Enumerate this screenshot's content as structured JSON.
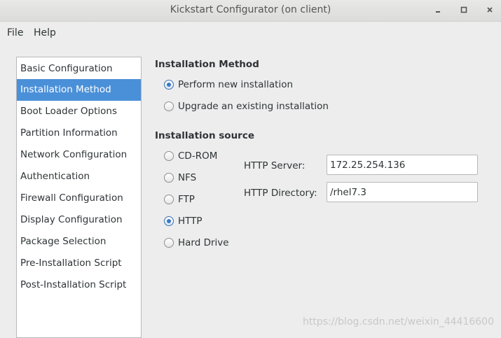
{
  "window": {
    "title": "Kickstart Configurator (on client)"
  },
  "menu": {
    "items": [
      {
        "label": "File"
      },
      {
        "label": "Help"
      }
    ]
  },
  "sidebar": {
    "items": [
      {
        "label": "Basic Configuration"
      },
      {
        "label": "Installation Method"
      },
      {
        "label": "Boot Loader Options"
      },
      {
        "label": "Partition Information"
      },
      {
        "label": "Network Configuration"
      },
      {
        "label": "Authentication"
      },
      {
        "label": "Firewall Configuration"
      },
      {
        "label": "Display Configuration"
      },
      {
        "label": "Package Selection"
      },
      {
        "label": "Pre-Installation Script"
      },
      {
        "label": "Post-Installation Script"
      }
    ],
    "selected": "Installation Method"
  },
  "installation_method": {
    "title": "Installation Method",
    "options": [
      {
        "label": "Perform new installation",
        "checked": true
      },
      {
        "label": "Upgrade an existing installation",
        "checked": false
      }
    ]
  },
  "installation_source": {
    "title": "Installation source",
    "options": [
      {
        "label": "CD-ROM",
        "checked": false
      },
      {
        "label": "NFS",
        "checked": false
      },
      {
        "label": "FTP",
        "checked": false
      },
      {
        "label": "HTTP",
        "checked": true
      },
      {
        "label": "Hard Drive",
        "checked": false
      }
    ],
    "http_server": {
      "label": "HTTP Server:",
      "value": "172.25.254.136"
    },
    "http_directory": {
      "label": "HTTP Directory:",
      "value": "/rhel7.3"
    }
  },
  "watermark": "https://blog.csdn.net/weixin_44416600",
  "colors": {
    "selection": "#4a90d9",
    "radio_checked": "#3b78c4",
    "window_bg": "#ededed"
  }
}
